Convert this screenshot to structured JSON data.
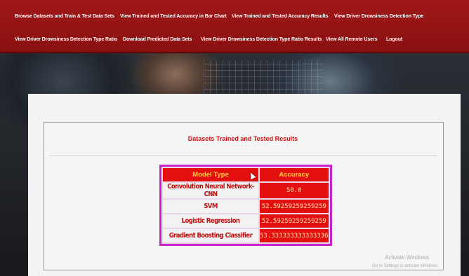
{
  "nav": {
    "items": [
      "Browse Datasets and Train & Test Data Sets",
      "View Trained and Tested Accuracy in Bar Chart",
      "View Trained and Tested Accuracy Results",
      "View Driver Drowsiness Detection Type",
      "View Driver Drowsiness Detection Type Ratio",
      "Download Predicted Data Sets",
      "View Driver Drowsiness Detection Type Ratio Results",
      "View All Remote Users",
      "Logout"
    ]
  },
  "results": {
    "title": "Datasets Trained and Tested Results",
    "headers": [
      "Model Type",
      "Accuracy"
    ],
    "rows": [
      {
        "model": "Convolution Neural Network-CNN",
        "accuracy": "50.0"
      },
      {
        "model": "SVM",
        "accuracy": "52.59259259259259"
      },
      {
        "model": "Logistic Regression",
        "accuracy": "52.59259259259259"
      },
      {
        "model": "Gradient Boosting Classifier",
        "accuracy": "53.333333333333336"
      }
    ]
  },
  "watermark": {
    "line1": "Activate Windows",
    "line2": "Go to Settings to activate Windows."
  },
  "colors": {
    "nav_bg": "#9b1414",
    "accent_red": "#e41010",
    "header_text": "#ffd23a",
    "table_border": "#cc22cc"
  }
}
